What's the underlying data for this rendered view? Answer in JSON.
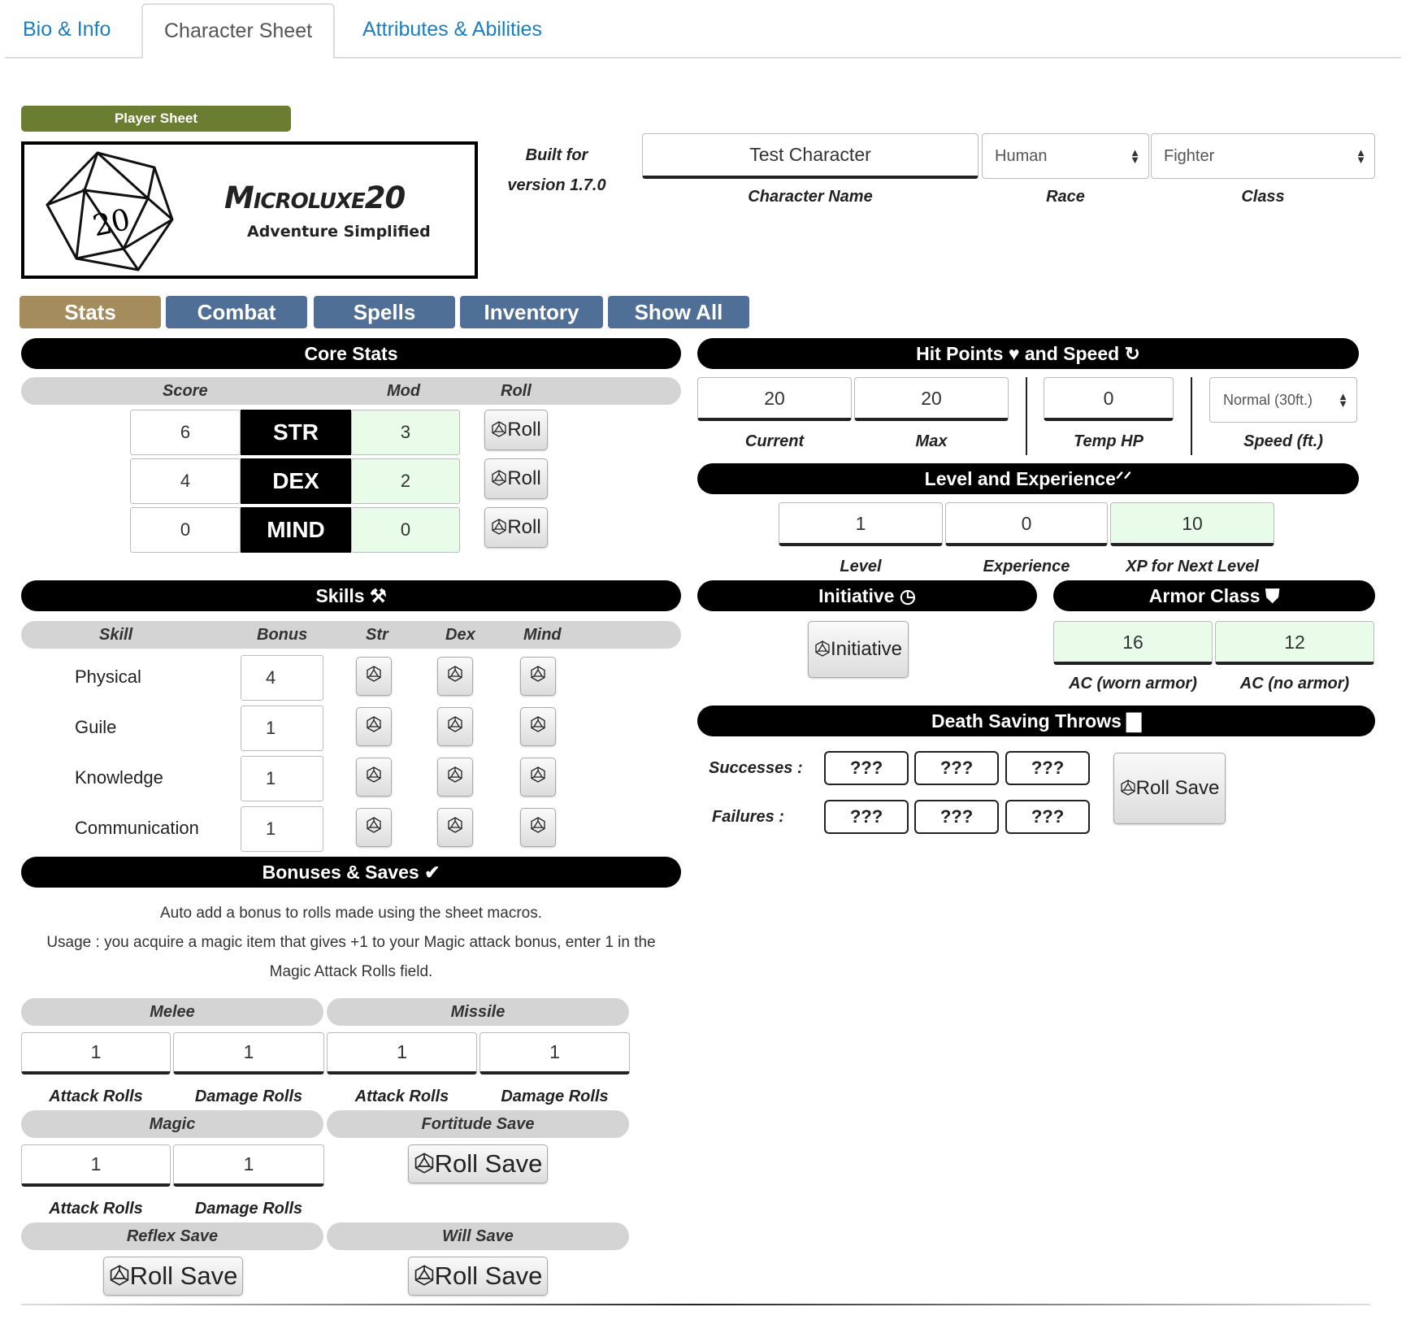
{
  "tabs": [
    "Bio & Info",
    "Character Sheet",
    "Attributes & Abilities"
  ],
  "player_sheet": "Player Sheet",
  "logo": {
    "die_number": "20",
    "title": "Microluxe20",
    "subtitle": "Adventure Simplified"
  },
  "built_for": {
    "line1": "Built for",
    "line2": "version 1.7.0"
  },
  "character": {
    "name": "Test Character",
    "race": "Human",
    "class": "Fighter",
    "name_label": "Character Name",
    "race_label": "Race",
    "class_label": "Class"
  },
  "nav": [
    "Stats",
    "Combat",
    "Spells",
    "Inventory",
    "Show All"
  ],
  "core_stats": {
    "title": "Core Stats",
    "headers": {
      "score": "Score",
      "mod": "Mod",
      "roll": "Roll"
    },
    "rows": [
      {
        "score": "6",
        "name": "STR",
        "mod": "3",
        "roll": "Roll"
      },
      {
        "score": "4",
        "name": "DEX",
        "mod": "2",
        "roll": "Roll"
      },
      {
        "score": "0",
        "name": "MIND",
        "mod": "0",
        "roll": "Roll"
      }
    ]
  },
  "skills": {
    "title": "Skills",
    "headers": {
      "skill": "Skill",
      "bonus": "Bonus",
      "str": "Str",
      "dex": "Dex",
      "mind": "Mind"
    },
    "rows": [
      {
        "name": "Physical",
        "bonus": "4"
      },
      {
        "name": "Guile",
        "bonus": "1"
      },
      {
        "name": "Knowledge",
        "bonus": "1"
      },
      {
        "name": "Communication",
        "bonus": "1"
      }
    ]
  },
  "bonuses": {
    "title": "Bonuses & Saves",
    "line1": "Auto add a bonus to rolls made using the sheet macros.",
    "line2": "Usage : you acquire a magic item that gives +1 to your Magic attack bonus, enter 1 in the",
    "line3": "Magic Attack Rolls field.",
    "melee": "Melee",
    "missile": "Missile",
    "magic": "Magic",
    "fortitude": "Fortitude Save",
    "reflex": "Reflex Save",
    "will": "Will Save",
    "melee_attack": "1",
    "melee_damage": "1",
    "missile_attack": "1",
    "missile_damage": "1",
    "magic_attack": "1",
    "magic_damage": "1",
    "attack_label": "Attack Rolls",
    "damage_label": "Damage Rolls",
    "roll_save": "Roll Save"
  },
  "hp": {
    "title": "Hit Points",
    "title2": "and Speed",
    "current": "20",
    "max": "20",
    "temp": "0",
    "speed": "Normal (30ft.)",
    "current_label": "Current",
    "max_label": "Max",
    "temp_label": "Temp HP",
    "speed_label": "Speed (ft.)"
  },
  "level": {
    "title": "Level and Experience",
    "level": "1",
    "xp": "0",
    "next": "10",
    "level_label": "Level",
    "xp_label": "Experience",
    "next_label": "XP for Next Level"
  },
  "initiative": {
    "title": "Initiative",
    "button": "Initiative"
  },
  "armor": {
    "title": "Armor Class",
    "worn": "16",
    "none": "12",
    "worn_label": "AC (worn armor)",
    "none_label": "AC (no armor)"
  },
  "death": {
    "title": "Death Saving Throws",
    "successes": "Successes :",
    "failures": "Failures :",
    "mark": "???",
    "roll": "Roll Save"
  }
}
